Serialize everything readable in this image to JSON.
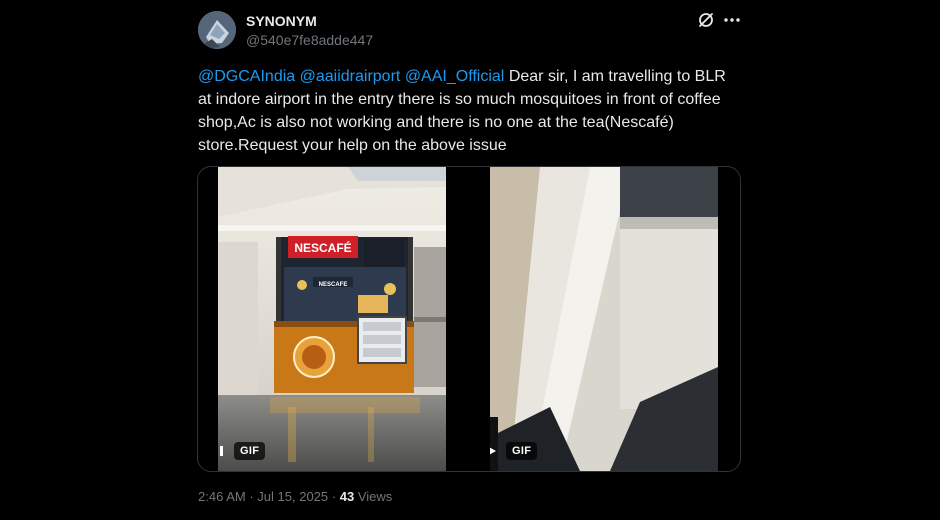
{
  "author": {
    "name": "SYNONYM",
    "handle": "@540e7fe8adde447"
  },
  "tweet": {
    "mentions": [
      "@DGCAIndia",
      "@aaiidrairport",
      "@AAI_Official"
    ],
    "body": "Dear sir, I am travelling to BLR at indore airport in the entry there is so much mosquitoes in front of coffee shop,Ac is also not working and there is no one at the tea(Nescafé) store.Request your help on the above issue"
  },
  "media": [
    {
      "type": "gif",
      "badge": "GIF",
      "state": "playing",
      "control_icon": "pause-icon",
      "sign_text": "NESCAFÉ",
      "kiosk_text": "NESCAFE"
    },
    {
      "type": "gif",
      "badge": "GIF",
      "state": "paused",
      "control_icon": "play-icon"
    }
  ],
  "meta": {
    "time": "2:46 AM",
    "separator": "·",
    "date": "Jul 15, 2025",
    "views_count": "43",
    "views_label": "Views"
  },
  "icons": {
    "grok": "grok-icon",
    "more": "more-icon"
  },
  "colors": {
    "background": "#000000",
    "text": "#e7e9ea",
    "secondary": "#71767b",
    "link": "#1d9bf0",
    "border": "#2f3336"
  }
}
